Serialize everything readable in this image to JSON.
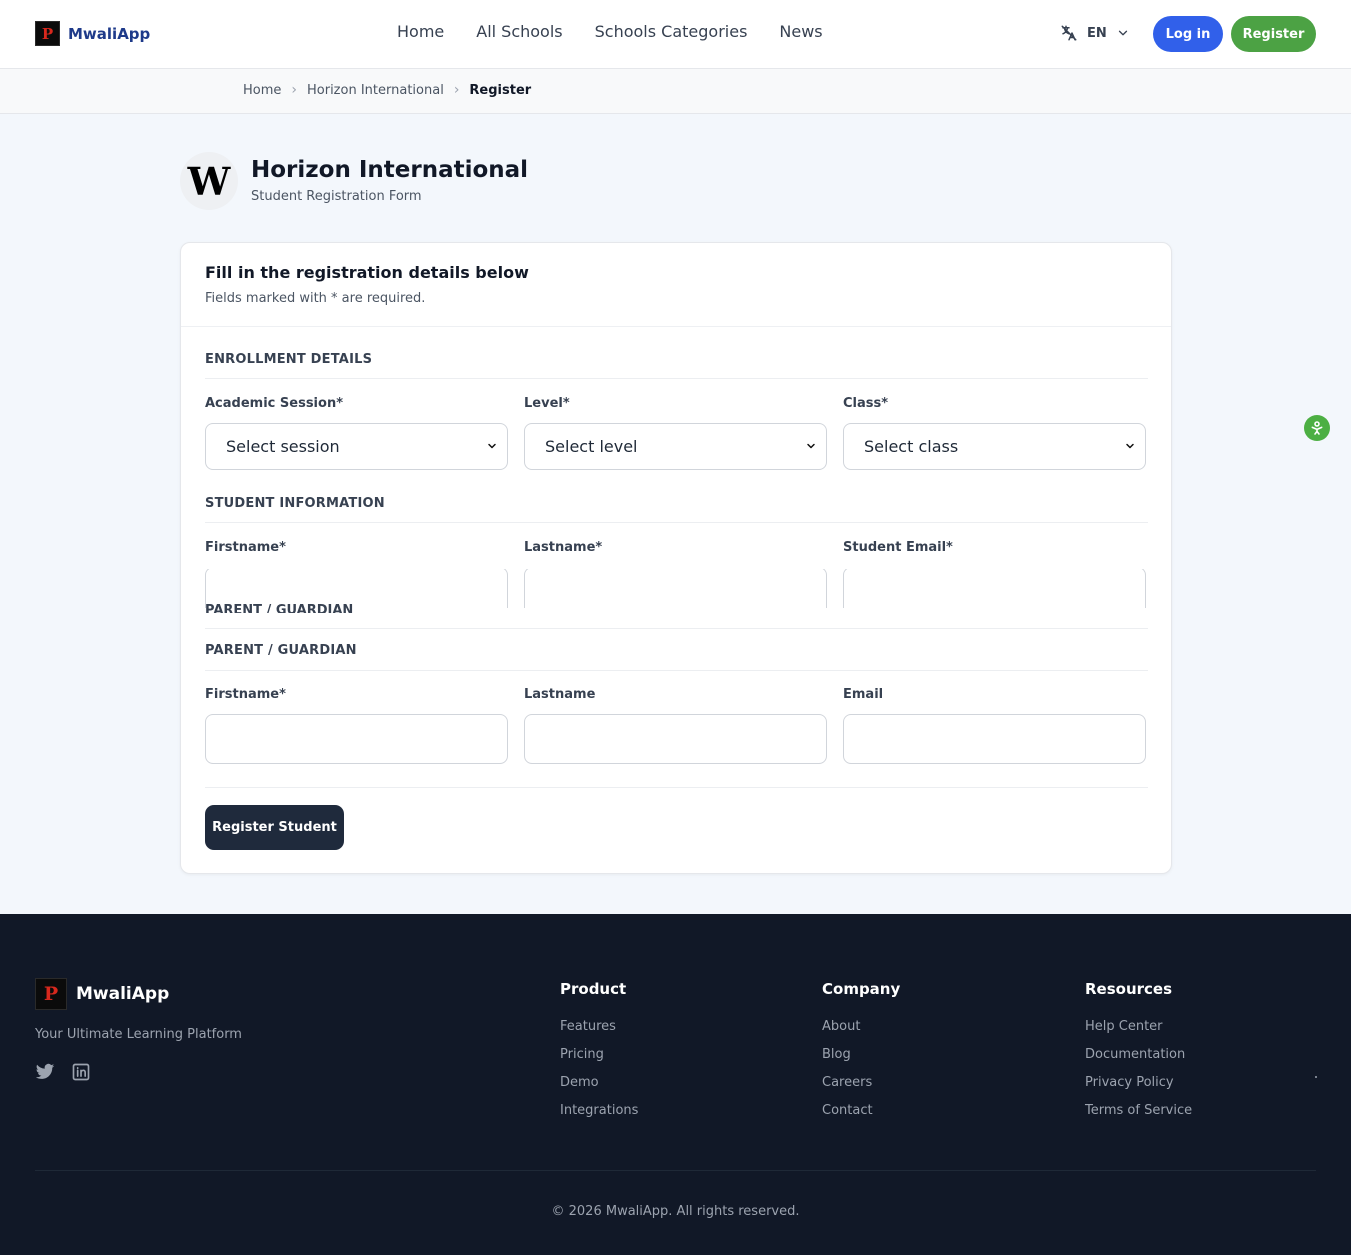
{
  "header": {
    "brand": "MwaliApp",
    "brand_logo_letter": "P",
    "nav": [
      "Home",
      "All Schools",
      "Schools Categories",
      "News"
    ],
    "language": "EN",
    "login_label": "Log in",
    "register_label": "Register"
  },
  "breadcrumb": [
    "Home",
    "Horizon International",
    "Register"
  ],
  "school": {
    "logo_letter": "W",
    "name": "Horizon International",
    "subtitle": "Student Registration Form"
  },
  "form": {
    "title": "Fill in the registration details below",
    "note": "Fields marked with * are required.",
    "enrollment": {
      "title": "ENROLLMENT DETAILS",
      "session_label": "Academic Session*",
      "session_value": "Select session",
      "level_label": "Level*",
      "level_value": "Select level",
      "class_label": "Class*",
      "class_value": "Select class"
    },
    "student": {
      "title": "STUDENT INFORMATION",
      "firstname_label": "Firstname*",
      "lastname_label": "Lastname*",
      "email_label": "Student Email*"
    },
    "guardian": {
      "title": "PARENT / GUARDIAN",
      "firstname_label": "Firstname*",
      "lastname_label": "Lastname",
      "email_label": "Email"
    },
    "submit_label": "Register Student"
  },
  "footer": {
    "brand": "MwaliApp",
    "brand_logo_letter": "P",
    "tagline": "Your Ultimate Learning Platform",
    "columns": [
      {
        "title": "Product",
        "links": [
          "Features",
          "Pricing",
          "Demo",
          "Integrations"
        ]
      },
      {
        "title": "Company",
        "links": [
          "About",
          "Blog",
          "Careers",
          "Contact"
        ]
      },
      {
        "title": "Resources",
        "links": [
          "Help Center",
          "Documentation",
          "Privacy Policy",
          "Terms of Service"
        ]
      }
    ],
    "copyright": "© 2026 MwaliApp. All rights reserved."
  },
  "colors": {
    "primary_blue": "#3160ea",
    "register_green": "#4ca244",
    "brand_text": "#1e3a8a",
    "footer_bg": "#111827",
    "submit_bg": "#1f2a3c"
  }
}
